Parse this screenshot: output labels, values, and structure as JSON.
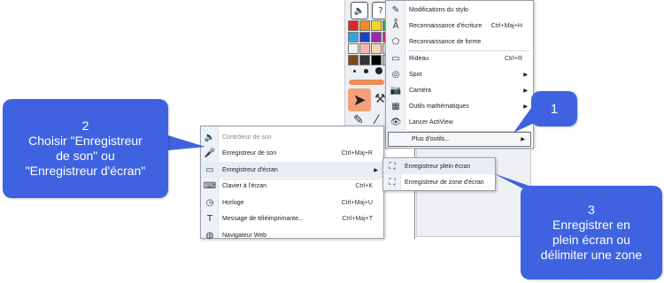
{
  "toolbar": {
    "top_icons": [
      "speaker-pen-icon",
      "question-icon"
    ],
    "swatches": [
      "#e3261f",
      "#f28c1a",
      "#f5d81c",
      "#2bb24a",
      "#2aa9e0",
      "#1c3fd0",
      "#9c27b0",
      "#e61e8c",
      "#f3f3f3",
      "#f5b7b1",
      "#f6d3b0",
      "#c8e6c9",
      "#7a4a1e",
      "#333333",
      "#000000",
      "#bdbdbd"
    ],
    "side_icons": [
      "pen-icon",
      "text-recognition-icon",
      "shape-recognition-icon",
      "curtain-icon",
      "spotlight-icon",
      "camera-icon",
      "calculator-icon",
      "eye-icon"
    ]
  },
  "main_menu": {
    "items": [
      {
        "label": "Modifications du stylo",
        "shortcut": "",
        "arrow": false
      },
      {
        "label": "Reconnaissance d'écriture",
        "shortcut": "Ctrl+Maj+H",
        "arrow": false
      },
      {
        "label": "Reconnaissance de forme",
        "shortcut": "",
        "arrow": false
      },
      {
        "label": "Rideau",
        "shortcut": "Ctrl+R",
        "arrow": false
      },
      {
        "label": "Spot",
        "shortcut": "",
        "arrow": true
      },
      {
        "label": "Caméra",
        "shortcut": "",
        "arrow": true
      },
      {
        "label": "Outils mathématiques",
        "shortcut": "",
        "arrow": true
      },
      {
        "label": "Lancer ActiView",
        "shortcut": "",
        "arrow": false
      },
      {
        "label": "Plus d'outils...",
        "shortcut": "",
        "arrow": true
      }
    ]
  },
  "tools_menu": {
    "items": [
      {
        "label": "Contrôleur de son",
        "shortcut": "",
        "arrow": false,
        "disabled": true
      },
      {
        "label": "Enregistreur de son",
        "shortcut": "Ctrl+Maj+R",
        "arrow": false
      },
      {
        "label": "Enregistreur d'écran",
        "shortcut": "",
        "arrow": true
      },
      {
        "label": "Clavier à l'écran",
        "shortcut": "Ctrl+K",
        "arrow": false
      },
      {
        "label": "Horloge",
        "shortcut": "Ctrl+Maj+U",
        "arrow": false
      },
      {
        "label": "Message de téléimprimante...",
        "shortcut": "Ctrl+Maj+T",
        "arrow": false
      },
      {
        "label": "Navigateur Web",
        "shortcut": "",
        "arrow": false
      }
    ]
  },
  "record_menu": {
    "items": [
      {
        "label": "Enregistreur plein écran"
      },
      {
        "label": "Enregistreur de zone d'écran"
      }
    ]
  },
  "callouts": {
    "one": {
      "number": "1"
    },
    "two": {
      "number": "2",
      "line1": "Choisir \"Enregistreur",
      "line2": "de son\" ou",
      "line3": "\"Enregistreur d'écran\""
    },
    "three": {
      "number": "3",
      "line1": "Enregistrer en",
      "line2": "plein écran ou",
      "line3": "délimiter une zone"
    }
  },
  "colors": {
    "callout": "#3f63e0",
    "highlight": "#e7edf6",
    "cursor_tile": "#f2a079"
  }
}
